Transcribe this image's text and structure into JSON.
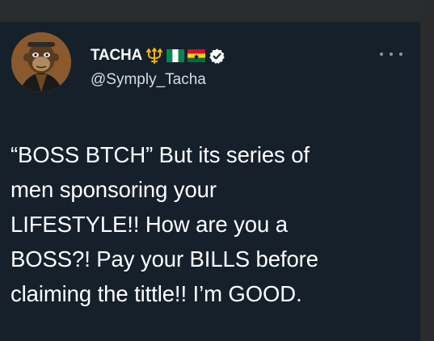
{
  "tweet": {
    "display_name": "TACHA",
    "handle": "@Symply_Tacha",
    "text": "“BOSS BTCH” But its series of\nmen sponsoring your\nLIFESTYLE!! How are you a\nBOSS?! Pay your BILLS before\nclaiming the tittle!! I’m GOOD.",
    "name_emojis": [
      "trident-emoji",
      "nigeria-flag-emoji",
      "ghana-flag-emoji"
    ],
    "verified": true
  },
  "colors": {
    "background": "#15202b",
    "text": "#ffffff",
    "secondary_text": "#d8dde1",
    "icon": "#8b98a5"
  }
}
